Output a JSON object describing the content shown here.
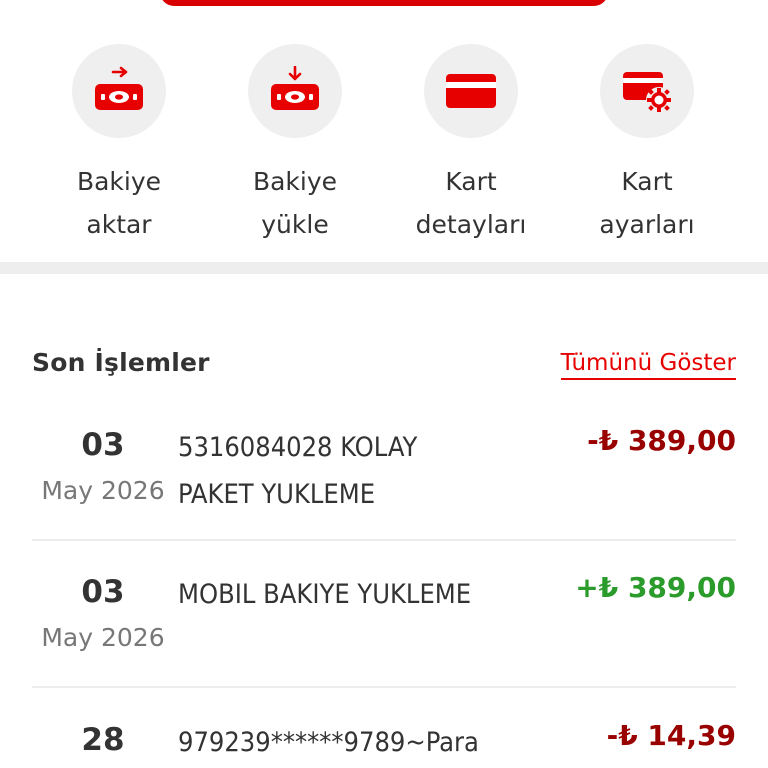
{
  "actions": [
    {
      "line1": "Bakiye",
      "line2": "aktar",
      "icon": "cash-transfer-icon"
    },
    {
      "line1": "Bakiye",
      "line2": "yükle",
      "icon": "cash-load-icon"
    },
    {
      "line1": "Kart",
      "line2": "detayları",
      "icon": "credit-card-icon"
    },
    {
      "line1": "Kart",
      "line2": "ayarları",
      "icon": "card-settings-icon"
    }
  ],
  "recent": {
    "title": "Son İşlemler",
    "show_all": "Tümünü Göster"
  },
  "transactions": [
    {
      "day": "03",
      "month": "May 2026",
      "desc1": "5316084028 KOLAY",
      "desc2": "PAKET YUKLEME",
      "amount": "-₺ 389,00",
      "sign": "negative"
    },
    {
      "day": "03",
      "month": "May 2026",
      "desc1": "MOBIL BAKIYE YUKLEME",
      "desc2": "",
      "amount": "+₺ 389,00",
      "sign": "positive"
    },
    {
      "day": "28",
      "month": "",
      "desc1": "979239******9789~Para",
      "desc2": "",
      "amount": "-₺ 14,39",
      "sign": "negative"
    }
  ],
  "colors": {
    "accent": "#e60000",
    "negative": "#990000",
    "positive": "#2b9b2b",
    "icon_bg": "#efefef"
  }
}
